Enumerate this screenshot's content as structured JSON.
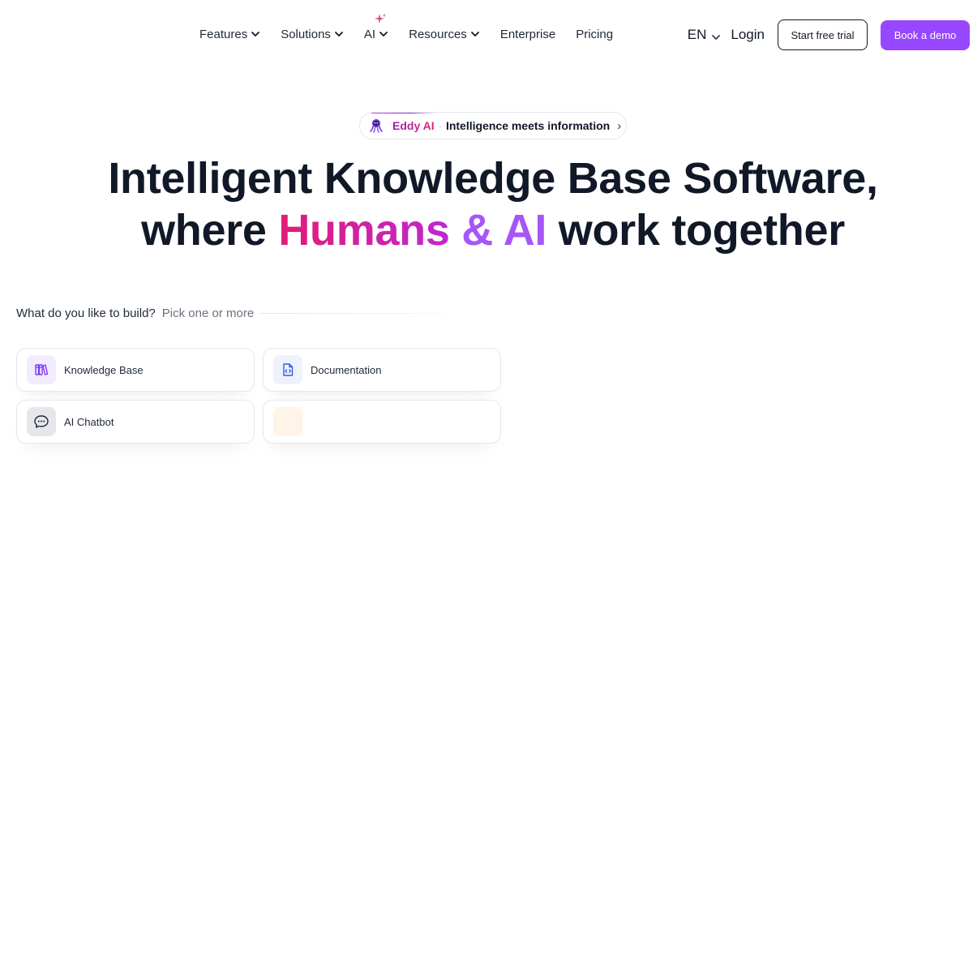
{
  "nav": {
    "items": [
      {
        "label": "Features",
        "has_dropdown": true
      },
      {
        "label": "Solutions",
        "has_dropdown": true
      },
      {
        "label": "AI",
        "has_dropdown": true,
        "icon": "sparkle-icon"
      },
      {
        "label": "Resources",
        "has_dropdown": true
      },
      {
        "label": "Enterprise",
        "has_dropdown": false
      },
      {
        "label": "Pricing",
        "has_dropdown": false
      }
    ],
    "language": "EN",
    "login": "Login",
    "trial_button": "Start free trial",
    "demo_button": "Book a demo"
  },
  "badge": {
    "icon": "octopus-mascot-icon",
    "brand": "Eddy AI",
    "separator": "·",
    "text": "Intelligence meets information",
    "arrow": "›"
  },
  "hero": {
    "line1": "Intelligent Knowledge Base Software,",
    "line2_prefix": "where ",
    "line2_highlight1": "Humans",
    "line2_highlight2": "& AI",
    "line2_suffix": " work together"
  },
  "picker": {
    "question": "What do you like to build?",
    "hint": "Pick one or more",
    "options": [
      {
        "label": "Knowledge Base",
        "icon": "books-icon",
        "icon_bg": "#f3ecff"
      },
      {
        "label": "Documentation",
        "icon": "code-document-icon",
        "icon_bg": "#eef2ff"
      },
      {
        "label": "AI Chatbot",
        "icon": "chat-bubble-icon",
        "icon_bg": "#e5e7eb"
      },
      {
        "label": "",
        "icon": "blank-icon",
        "icon_bg": "#fff4e5"
      }
    ]
  },
  "colors": {
    "accent_purple": "#9747ff",
    "hero_pink": "#db2777",
    "hero_purple": "#a855f7",
    "text_dark": "#111827"
  }
}
